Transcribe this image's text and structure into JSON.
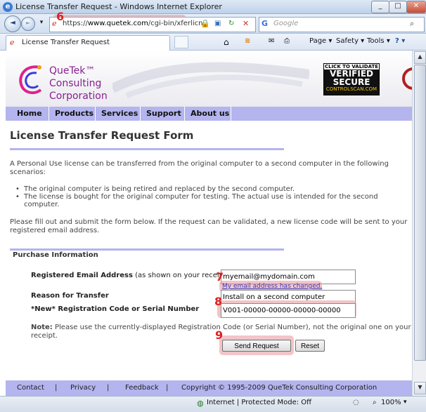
{
  "window": {
    "title": "License Transfer Request - Windows Internet Explorer",
    "min": "_",
    "max": "□",
    "close": "✕"
  },
  "nav": {
    "url_scheme": "https://",
    "url_domain": "www.quetek.com",
    "url_path": "/cgi-bin/xferlicn",
    "search_placeholder": "Google",
    "back": "◄",
    "forward": "►"
  },
  "tabbar": {
    "tab_title": "License Transfer Request",
    "commands": {
      "page": "Page ▾",
      "safety": "Safety ▾",
      "tools": "Tools ▾",
      "help": "? ▾"
    }
  },
  "brand": {
    "name_line1": "QueTek™",
    "name_line2": "Consulting",
    "name_line3": "Corporation",
    "badge_top": "CLICK TO VALIDATE",
    "badge_line1": "VERIFIED",
    "badge_line2": "SECURE",
    "badge_bottom": "CONTROLSCAN.COM"
  },
  "menu": [
    "Home",
    "Products",
    "Services",
    "Support",
    "About us"
  ],
  "page": {
    "title": "License Transfer Request Form",
    "intro": "A Personal Use license can be transferred from the original computer to a second computer in the following scenarios:",
    "bullets": [
      "The original computer is being retired and replaced by the second computer.",
      "The license is bought for the original computer for testing. The actual use is intended for the second computer."
    ],
    "instructions": "Please fill out and submit the form below. If the request can be validated, a new license code will be sent to your registered email address.",
    "section": "Purchase Information"
  },
  "form": {
    "email_label": "Registered Email Address",
    "email_hint": "(as shown on your receipt)",
    "email_value": "myemail@mydomain.com",
    "email_changed_link": "My email address has changed.",
    "reason_label": "Reason for Transfer",
    "reason_value": "Install on a second computer",
    "code_label": "*New* Registration Code or Serial Number",
    "code_value": "V001-00000-00000-00000-00000",
    "note_bold": "Note:",
    "note_text": "Please use the currently-displayed Registration Code (or Serial Number), not the original one on your receipt.",
    "submit_label": "Send Request",
    "reset_label": "Reset"
  },
  "steps": {
    "s6": "6",
    "s7": "7",
    "s8": "8",
    "s9": "9"
  },
  "footer": {
    "contact": "Contact",
    "privacy": "Privacy",
    "feedback": "Feedback",
    "copyright": "Copyright © 1995-2009 QueTek Consulting Corporation",
    "sep": "|"
  },
  "status": {
    "zone": "Internet | Protected Mode: Off",
    "zoom": "100%"
  },
  "colors": {
    "accent_lavender": "#b4b4ef",
    "highlight_pink": "#e8969b",
    "brand_purple": "#8a1f8f",
    "step_red": "#dd2222"
  }
}
